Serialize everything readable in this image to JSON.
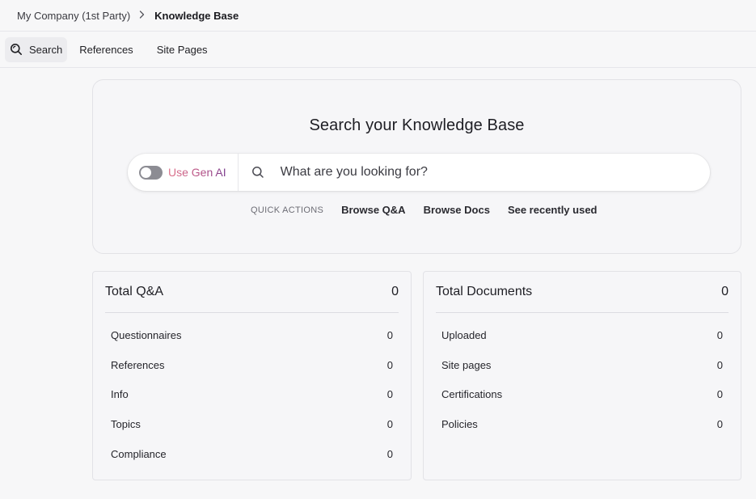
{
  "breadcrumb": {
    "parent": "My Company (1st Party)",
    "separator": ">",
    "current": "Knowledge Base"
  },
  "tabs": [
    {
      "label": "Search",
      "icon": "search-icon",
      "active": true
    },
    {
      "label": "References",
      "active": false
    },
    {
      "label": "Site Pages",
      "active": false
    }
  ],
  "hero": {
    "title": "Search your Knowledge Base",
    "gen_ai_label": "Use Gen AI",
    "gen_ai_enabled": false,
    "search_placeholder": "What are you looking for?",
    "quick_actions_label": "QUICK ACTIONS",
    "quick_actions": [
      "Browse Q&A",
      "Browse Docs",
      "See recently used"
    ]
  },
  "qa_card": {
    "title": "Total Q&A",
    "total": "0",
    "rows": [
      {
        "label": "Questionnaires",
        "value": "0"
      },
      {
        "label": "References",
        "value": "0"
      },
      {
        "label": "Info",
        "value": "0"
      },
      {
        "label": "Topics",
        "value": "0"
      },
      {
        "label": "Compliance",
        "value": "0"
      }
    ]
  },
  "docs_card": {
    "title": "Total Documents",
    "total": "0",
    "rows": [
      {
        "label": "Uploaded",
        "value": "0"
      },
      {
        "label": "Site pages",
        "value": "0"
      },
      {
        "label": "Certifications",
        "value": "0"
      },
      {
        "label": "Policies",
        "value": "0"
      }
    ]
  },
  "colors": {
    "background": "#f7f7f8",
    "gen_ai_gradient_start": "#e0738a",
    "gen_ai_gradient_end": "#7a3c8e",
    "toggle_off": "#8c8c93"
  }
}
